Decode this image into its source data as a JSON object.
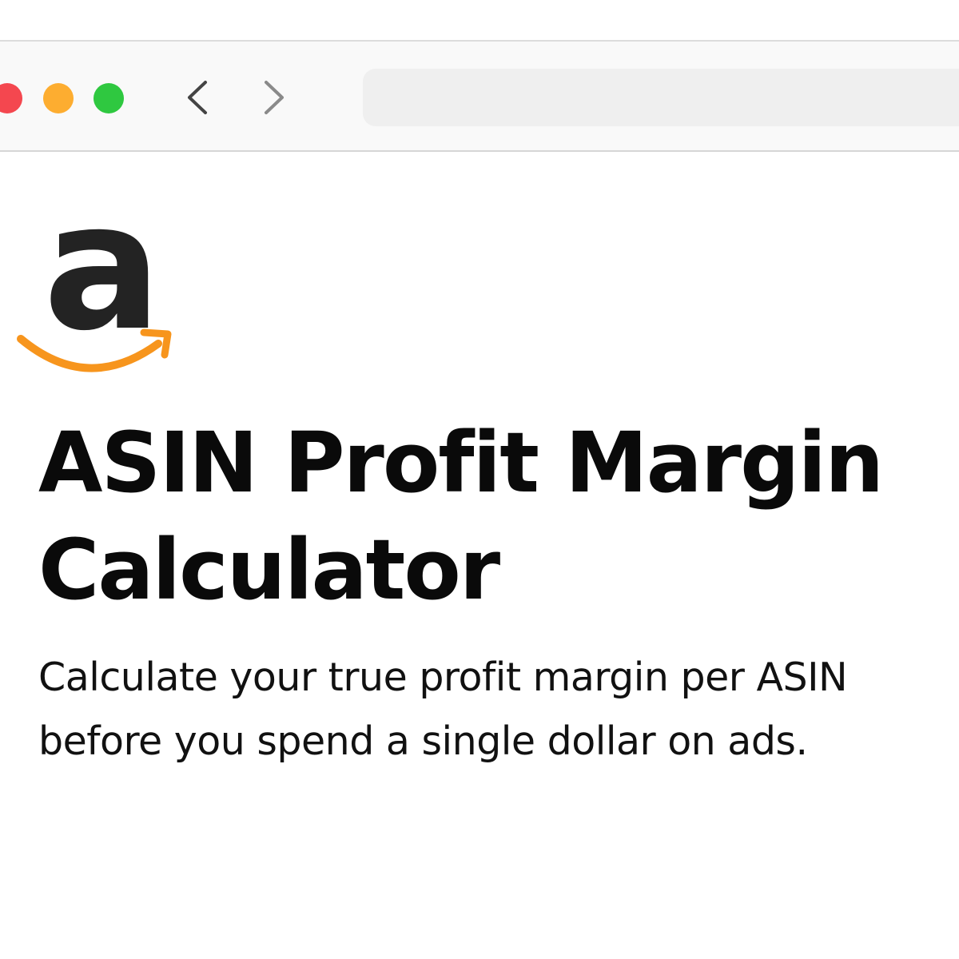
{
  "browser": {
    "window_controls": [
      "close",
      "minimize",
      "maximize"
    ],
    "nav": {
      "back_icon": "chevron-left-icon",
      "forward_icon": "chevron-right-icon"
    },
    "address_bar": {
      "value": ""
    }
  },
  "logo": {
    "name": "amazon-logo",
    "letter": "a",
    "colors": {
      "letter": "#232323",
      "smile": "#f7951d"
    }
  },
  "content": {
    "title": "ASIN Profit Margin Calculator",
    "subtitle": "Calculate your true profit margin per ASIN before you spend a single dollar on ads."
  },
  "colors": {
    "close": "#f4474f",
    "minimize": "#fdad30",
    "maximize": "#2fc840",
    "chrome_bg": "#f9f9f9",
    "address_bg": "#efefef"
  }
}
